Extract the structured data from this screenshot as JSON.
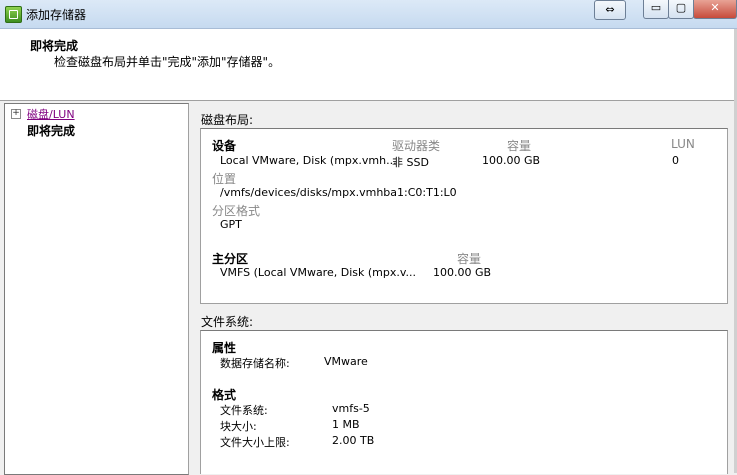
{
  "window": {
    "title": "添加存储器"
  },
  "titlebar": {
    "swap_symbol": "⇔",
    "min_symbol": "▭",
    "max_symbol": "▢",
    "close_symbol": "✕"
  },
  "header": {
    "title": "即将完成",
    "description": "检查磁盘布局并单击\"完成\"添加\"存储器\"。"
  },
  "nav": {
    "expander": "+",
    "link": "磁盘/LUN",
    "current": "即将完成"
  },
  "disk_layout": {
    "label": "磁盘布局:",
    "device_header": "设备",
    "driver_type_header": "驱动器类",
    "capacity_header": "容量",
    "lun_header": "LUN",
    "device_name": "Local VMware, Disk (mpx.vmh...",
    "driver_type": "非 SSD",
    "capacity": "100.00 GB",
    "lun": "0",
    "location_label": "位置",
    "location_value": "/vmfs/devices/disks/mpx.vmhba1:C0:T1:L0",
    "partition_format_label": "分区格式",
    "partition_format_value": "GPT",
    "primary_partition_header": "主分区",
    "primary_capacity_header": "容量",
    "primary_partition_name": "VMFS (Local VMware, Disk (mpx.v...",
    "primary_partition_capacity": "100.00 GB"
  },
  "file_system": {
    "label": "文件系统:",
    "properties_header": "属性",
    "datastore_name_label": "数据存储名称:",
    "datastore_name_value": "VMware",
    "format_header": "格式",
    "fs_label": "文件系统:",
    "fs_value": "vmfs-5",
    "block_size_label": "块大小:",
    "block_size_value": "1 MB",
    "max_file_size_label": "文件大小上限:",
    "max_file_size_value": "2.00 TB"
  }
}
